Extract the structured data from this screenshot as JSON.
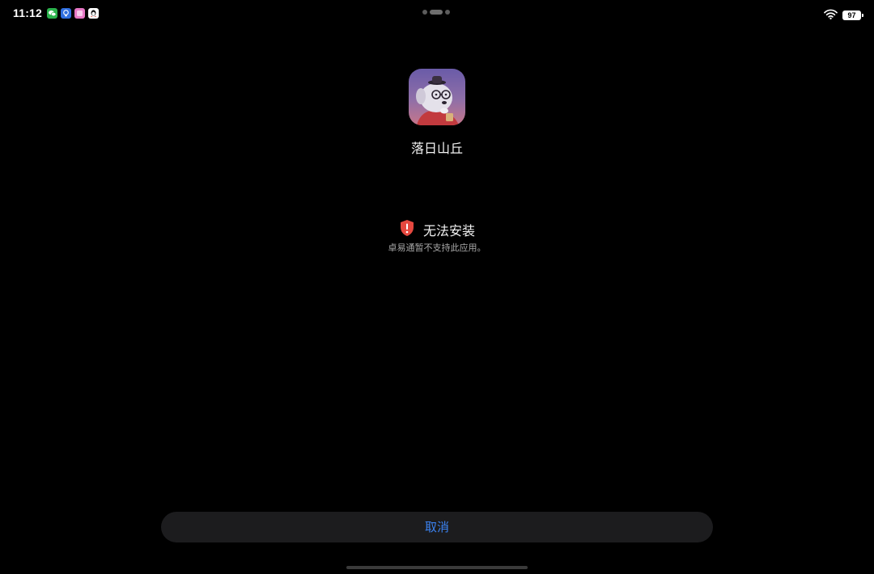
{
  "status_bar": {
    "time": "11:12",
    "notification_icons": [
      "wechat-icon",
      "bulb-app-icon",
      "pink-app-icon",
      "qq-icon"
    ],
    "battery_level": "97",
    "wifi": "wifi-icon"
  },
  "app": {
    "name": "落日山丘",
    "icon": "app-icon-dog-character"
  },
  "error": {
    "icon": "shield-alert-icon",
    "title": "无法安装",
    "description": "卓易通暂不支持此应用。",
    "accent_color": "#e5483f"
  },
  "actions": {
    "cancel_label": "取消",
    "cancel_color": "#3b82f0"
  }
}
